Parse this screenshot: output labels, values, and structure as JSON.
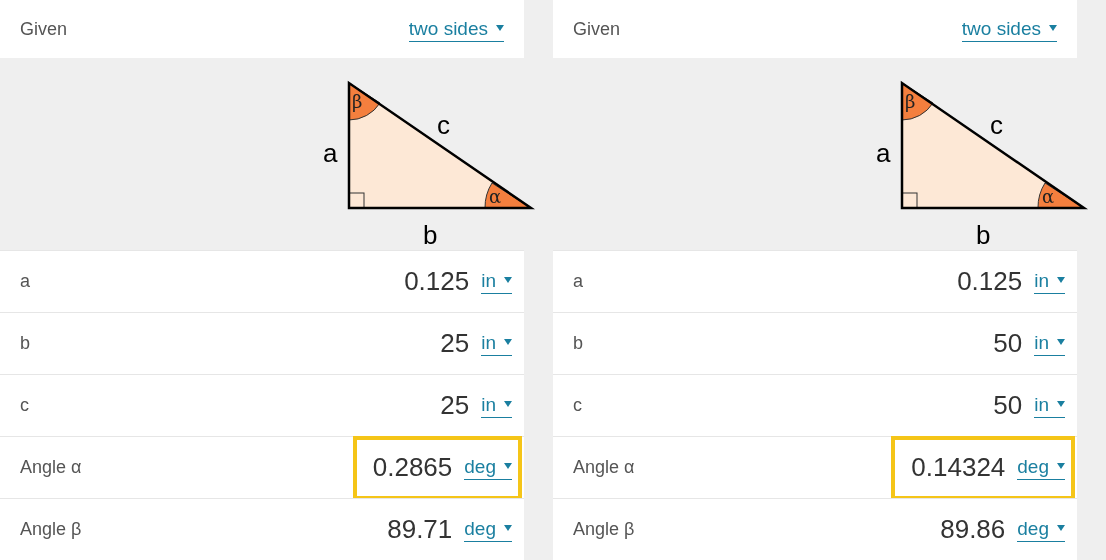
{
  "panels": [
    {
      "given": {
        "label": "Given",
        "value": "two sides"
      },
      "diagram": {
        "side_a": "a",
        "side_b": "b",
        "side_c": "c",
        "angle_alpha": "α",
        "angle_beta": "β"
      },
      "rows": [
        {
          "label": "a",
          "value": "0.125",
          "unit": "in",
          "highlighted": false
        },
        {
          "label": "b",
          "value": "25",
          "unit": "in",
          "highlighted": false
        },
        {
          "label": "c",
          "value": "25",
          "unit": "in",
          "highlighted": false
        },
        {
          "label": "Angle α",
          "value": "0.2865",
          "unit": "deg",
          "highlighted": true
        },
        {
          "label": "Angle β",
          "value": "89.71",
          "unit": "deg",
          "highlighted": false
        }
      ]
    },
    {
      "given": {
        "label": "Given",
        "value": "two sides"
      },
      "diagram": {
        "side_a": "a",
        "side_b": "b",
        "side_c": "c",
        "angle_alpha": "α",
        "angle_beta": "β"
      },
      "rows": [
        {
          "label": "a",
          "value": "0.125",
          "unit": "in",
          "highlighted": false
        },
        {
          "label": "b",
          "value": "50",
          "unit": "in",
          "highlighted": false
        },
        {
          "label": "c",
          "value": "50",
          "unit": "in",
          "highlighted": false
        },
        {
          "label": "Angle α",
          "value": "0.14324",
          "unit": "deg",
          "highlighted": true
        },
        {
          "label": "Angle β",
          "value": "89.86",
          "unit": "deg",
          "highlighted": false
        }
      ]
    }
  ]
}
